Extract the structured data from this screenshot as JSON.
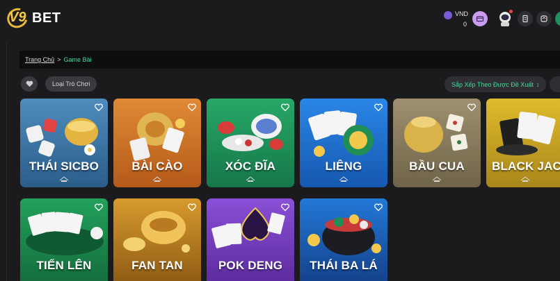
{
  "header": {
    "logo_v9": "V9",
    "logo_bet": "BET",
    "wallet_currency": "VND",
    "wallet_balance": "0"
  },
  "breadcrumb": {
    "home": "Trang Chủ",
    "separator": ">",
    "current": "Game Bài"
  },
  "filters": {
    "type_label": "Loại Trò Chơi",
    "sort_label": "Sắp Xếp Theo Được Đề Xuất",
    "sort_icon": "↕"
  },
  "games": [
    {
      "title": "THÁI SICBO",
      "icon": "dice-bowl-art",
      "bg": "#3f78a6"
    },
    {
      "title": "BÀI CÀO",
      "icon": "cards-coins-art",
      "bg": "#d2772a"
    },
    {
      "title": "XÓC ĐĨA",
      "icon": "plate-chips-art",
      "bg": "#1f9b5c"
    },
    {
      "title": "LIÊNG",
      "icon": "cards-chip-art",
      "bg": "#1d72d0"
    },
    {
      "title": "BẦU CUA",
      "icon": "gourd-dice-art",
      "bg": "#8f8362"
    },
    {
      "title": "BLACK JAC",
      "icon": "blackjack-cards-art",
      "bg": "#c8a41e"
    },
    {
      "title": "TIẾN LÊN",
      "icon": "cards-table-art",
      "bg": "#1d8a4e"
    },
    {
      "title": "FAN TAN",
      "icon": "gold-bowl-art",
      "bg": "#c98a26"
    },
    {
      "title": "POK DENG",
      "icon": "spade-cards-art",
      "bg": "#7a3fc2"
    },
    {
      "title": "THÁI BA LÁ",
      "icon": "pot-chips-art",
      "bg": "#1a5fb8"
    }
  ]
}
